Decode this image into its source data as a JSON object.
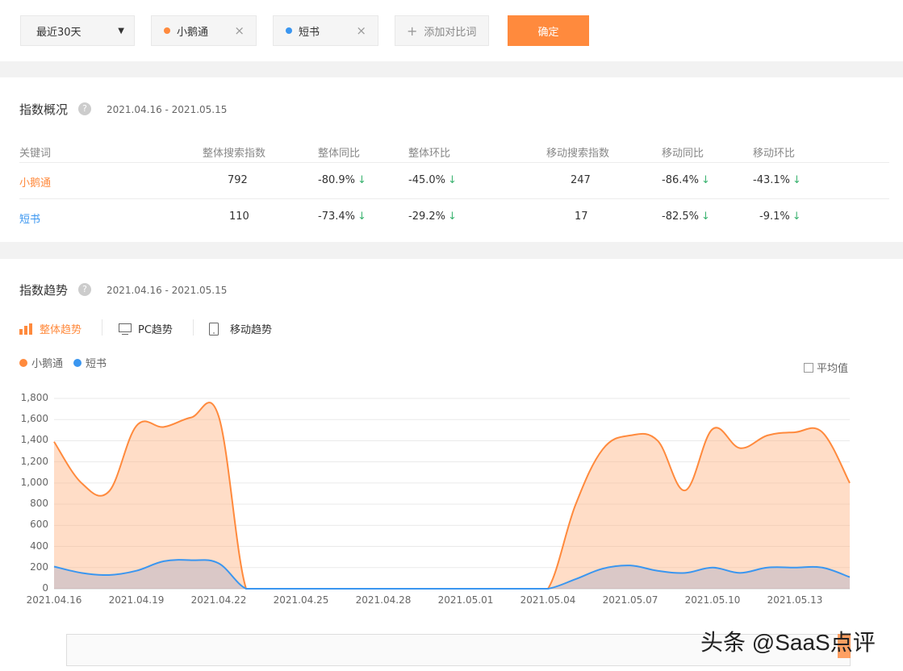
{
  "toolbar": {
    "period": "最近30天",
    "keyword1": "小鹅通",
    "keyword2": "短书",
    "add_compare": "添加对比词",
    "confirm": "确定"
  },
  "overview": {
    "title": "指数概况",
    "range": "2021.04.16 - 2021.05.15",
    "headers": [
      "关键词",
      "整体搜索指数",
      "整体同比",
      "整体环比",
      "移动搜索指数",
      "移动同比",
      "移动环比"
    ],
    "rows": [
      {
        "keyword": "小鹅通",
        "total": "792",
        "yoy": "-80.9%",
        "mom": "-45.0%",
        "mobile": "247",
        "m_yoy": "-86.4%",
        "m_mom": "-43.1%"
      },
      {
        "keyword": "短书",
        "total": "110",
        "yoy": "-73.4%",
        "mom": "-29.2%",
        "mobile": "17",
        "m_yoy": "-82.5%",
        "m_mom": "-9.1%"
      }
    ]
  },
  "trend": {
    "title": "指数趋势",
    "range": "2021.04.16 - 2021.05.15",
    "tabs": [
      "整体趋势",
      "PC趋势",
      "移动趋势"
    ],
    "legend": [
      "小鹅通",
      "短书"
    ],
    "avg_label": "平均值"
  },
  "colors": {
    "orange": "#ff8a3d",
    "blue": "#3a96f0",
    "down": "#3cb371"
  },
  "watermark": "头条 @SaaS点评",
  "chart_data": {
    "type": "area",
    "x": [
      "2021.04.16",
      "2021.04.17",
      "2021.04.18",
      "2021.04.19",
      "2021.04.20",
      "2021.04.21",
      "2021.04.22",
      "2021.04.23",
      "2021.04.24",
      "2021.04.25",
      "2021.04.26",
      "2021.04.27",
      "2021.04.28",
      "2021.04.29",
      "2021.04.30",
      "2021.05.01",
      "2021.05.02",
      "2021.05.03",
      "2021.05.04",
      "2021.05.05",
      "2021.05.06",
      "2021.05.07",
      "2021.05.08",
      "2021.05.09",
      "2021.05.10",
      "2021.05.11",
      "2021.05.12",
      "2021.05.13",
      "2021.05.14",
      "2021.05.15"
    ],
    "xticks": [
      "2021.04.16",
      "2021.04.19",
      "2021.04.22",
      "2021.04.25",
      "2021.04.28",
      "2021.05.01",
      "2021.05.04",
      "2021.05.07",
      "2021.05.10",
      "2021.05.13"
    ],
    "yticks": [
      "0",
      "200",
      "400",
      "600",
      "800",
      "1,000",
      "1,200",
      "1,400",
      "1,600",
      "1,800"
    ],
    "ylim": [
      0,
      1800
    ],
    "series": [
      {
        "name": "小鹅通",
        "values": [
          1390,
          1000,
          920,
          1540,
          1530,
          1620,
          1630,
          0,
          0,
          0,
          0,
          0,
          0,
          0,
          0,
          0,
          0,
          0,
          0,
          790,
          1320,
          1450,
          1400,
          930,
          1510,
          1330,
          1450,
          1480,
          1480,
          1000
        ]
      },
      {
        "name": "短书",
        "values": [
          210,
          150,
          130,
          170,
          260,
          270,
          240,
          0,
          0,
          0,
          0,
          0,
          0,
          0,
          0,
          0,
          0,
          0,
          0,
          90,
          190,
          220,
          170,
          150,
          200,
          150,
          200,
          200,
          200,
          110
        ]
      }
    ],
    "grid": true,
    "legend_position": "top-left"
  }
}
